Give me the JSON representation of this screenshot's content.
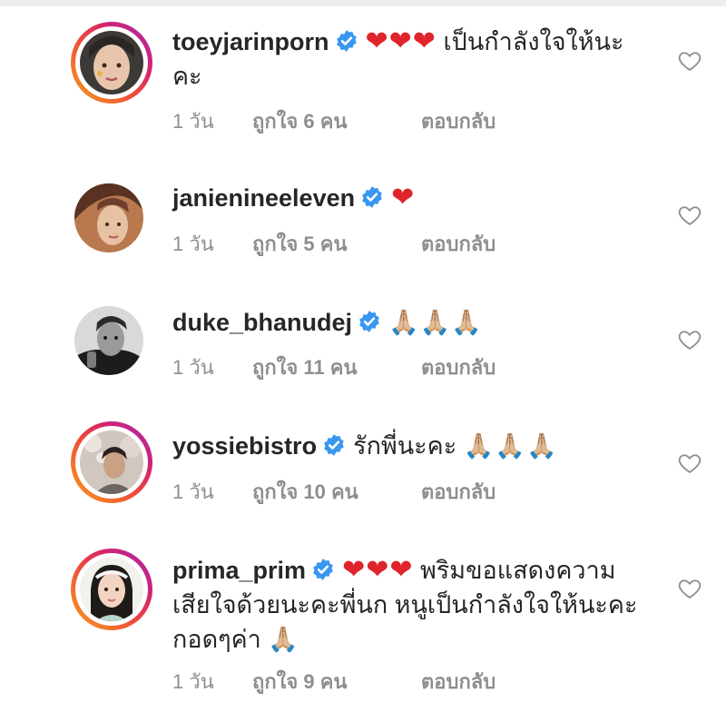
{
  "comments": [
    {
      "username": "toeyjarinporn",
      "emoji": "❤❤❤",
      "text": " เป็นกำลังใจให้นะคะ",
      "age": "1 วัน",
      "likes": "ถูกใจ 6 คน",
      "reply": "ตอบกลับ"
    },
    {
      "username": "janienineeleven",
      "emoji": "❤",
      "text": "",
      "age": "1 วัน",
      "likes": "ถูกใจ 5 คน",
      "reply": "ตอบกลับ"
    },
    {
      "username": "duke_bhanudej",
      "emoji": "🙏🏼🙏🏼🙏🏼",
      "text": "",
      "age": "1 วัน",
      "likes": "ถูกใจ 11 คน",
      "reply": "ตอบกลับ"
    },
    {
      "username": "yossiebistro",
      "text": "รักพี่นะคะ ",
      "emoji": "🙏🏼🙏🏼🙏🏼",
      "age": "1 วัน",
      "likes": "ถูกใจ 10 คน",
      "reply": "ตอบกลับ"
    },
    {
      "username": "prima_prim",
      "emoji": "❤❤❤",
      "text": " พริมขอแสดงความเสียใจด้วยนะคะพี่นก หนูเป็นกำลังใจให้นะคะ กอดๆค่า",
      "emoji_end": "🙏🏼",
      "age": "1 วัน",
      "likes": "ถูกใจ 9 คน",
      "reply": "ตอบกลับ"
    }
  ],
  "icons": {
    "verified": "verified-badge-icon",
    "like": "heart-outline-icon"
  },
  "colors": {
    "verified_blue": "#3897f0",
    "heart_red": "#e0242c",
    "meta_gray": "#8e8e8e",
    "text": "#262626"
  }
}
